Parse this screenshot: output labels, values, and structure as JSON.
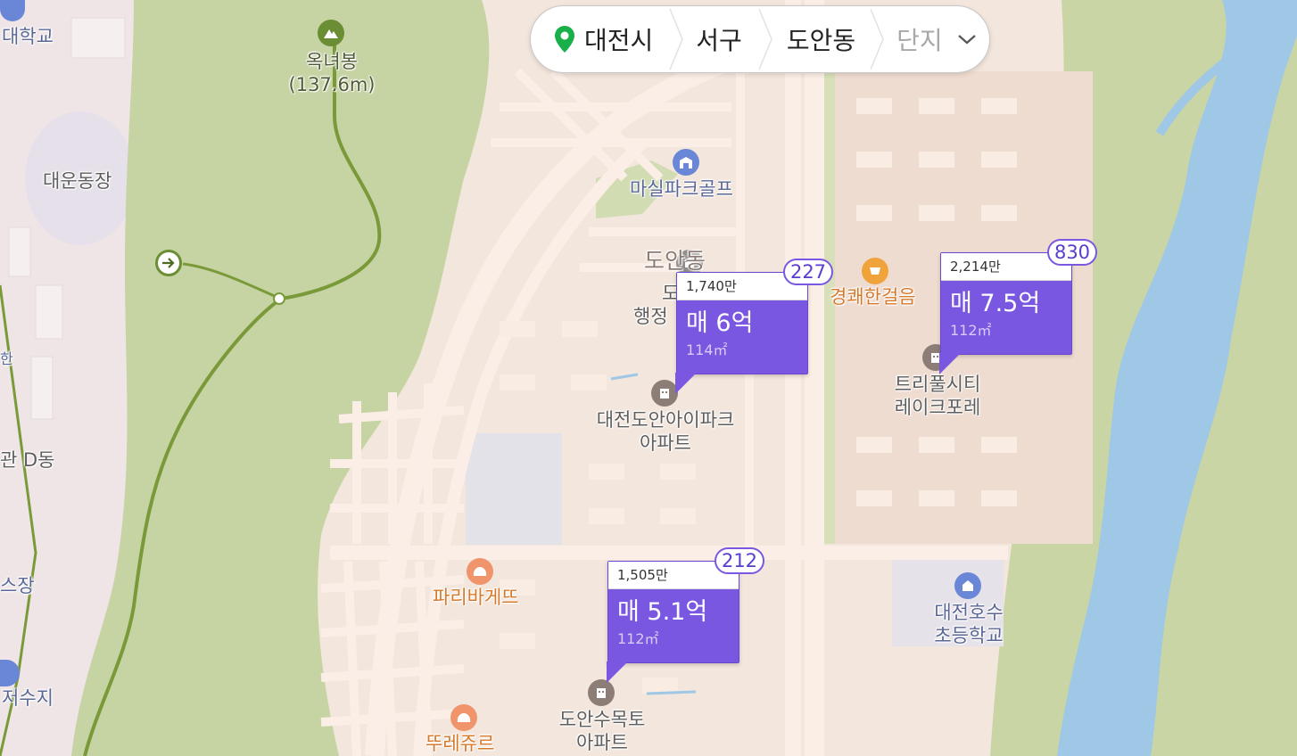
{
  "breadcrumb": {
    "city": "대전시",
    "district": "서구",
    "dong": "도안동",
    "complex_placeholder": "단지",
    "pin_color": "#19b04a"
  },
  "labels": {
    "university": "대학교",
    "peak_name": "옥녀봉",
    "peak_height": "(137.6m)",
    "stadium": "대운동장",
    "dong_area": "도안동",
    "admin_center_1": "도",
    "admin_center_2": "행정",
    "golf": "마실파크골프",
    "trail": "경쾌한걸음",
    "apt_ipark_1": "대전도안아이파크",
    "apt_ipark_2": "아파트",
    "apt_tripul_1": "트리풀시티",
    "apt_tripul_2": "레이크포레",
    "paris": "파리바게뜨",
    "tous": "뚜레쥬르",
    "apt_sumok_1": "도안수목토",
    "apt_sumok_2": "아파트",
    "school_1": "대전호수",
    "school_2": "초등학교",
    "left_d": "관 D동",
    "left_seu": "스장",
    "left_reservoir": "저수지",
    "left_edge": "한"
  },
  "markers": [
    {
      "unit_price": "1,740만",
      "price": "매 6억",
      "area": "114㎡",
      "count": "227"
    },
    {
      "unit_price": "2,214만",
      "price": "매 7.5억",
      "area": "112㎡",
      "count": "830"
    },
    {
      "unit_price": "1,505만",
      "price": "매 5.1억",
      "area": "112㎡",
      "count": "212"
    }
  ],
  "colors": {
    "marker": "#7a57e0",
    "park": "#c6d3a3",
    "river": "#9fc7e6",
    "road": "#fbeee6",
    "base": "#f3e6dc"
  }
}
